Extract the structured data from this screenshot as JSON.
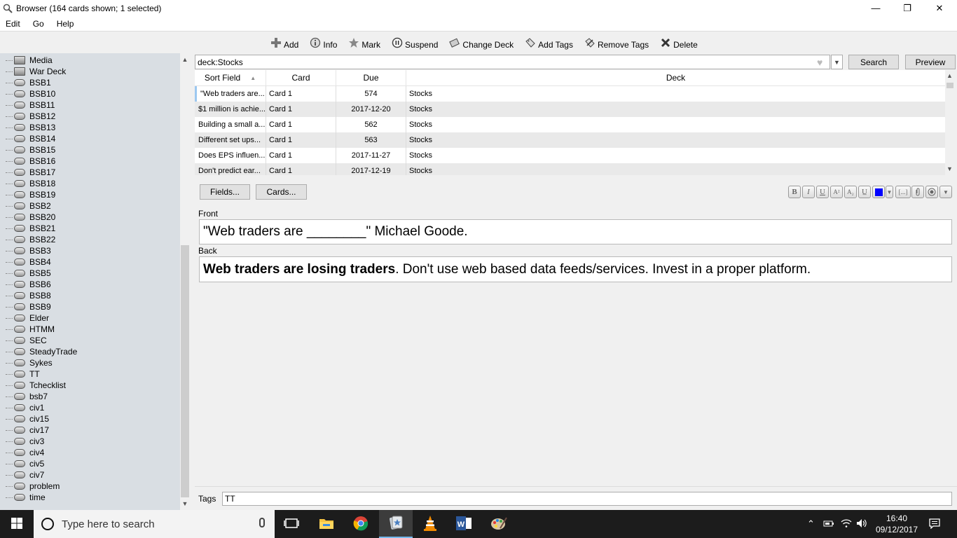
{
  "window": {
    "title": "Browser (164 cards shown; 1 selected)",
    "minimize": "—",
    "maximize": "❐",
    "close": "✕"
  },
  "menu": [
    "Edit",
    "Go",
    "Help"
  ],
  "toolbar": [
    {
      "label": "Add",
      "icon": "add-icon"
    },
    {
      "label": "Info",
      "icon": "info-icon"
    },
    {
      "label": "Mark",
      "icon": "star-icon"
    },
    {
      "label": "Suspend",
      "icon": "pause-icon"
    },
    {
      "label": "Change Deck",
      "icon": "deck-icon"
    },
    {
      "label": "Add Tags",
      "icon": "tag-add-icon"
    },
    {
      "label": "Remove Tags",
      "icon": "tag-remove-icon"
    },
    {
      "label": "Delete",
      "icon": "delete-icon"
    }
  ],
  "sidebar": {
    "items": [
      "Media",
      "War Deck",
      "BSB1",
      "BSB10",
      "BSB11",
      "BSB12",
      "BSB13",
      "BSB14",
      "BSB15",
      "BSB16",
      "BSB17",
      "BSB18",
      "BSB19",
      "BSB2",
      "BSB20",
      "BSB21",
      "BSB22",
      "BSB3",
      "BSB4",
      "BSB5",
      "BSB6",
      "BSB8",
      "BSB9",
      "Elder",
      "HTMM",
      "SEC",
      "SteadyTrade",
      "Sykes",
      "TT",
      "Tchecklist",
      "bsb7",
      "civ1",
      "civ15",
      "civ17",
      "civ3",
      "civ4",
      "civ5",
      "civ7",
      "problem",
      "time"
    ]
  },
  "search": {
    "value": "deck:Stocks",
    "search_label": "Search",
    "preview_label": "Preview"
  },
  "table": {
    "columns": [
      "Sort Field",
      "Card",
      "Due",
      "Deck"
    ],
    "rows": [
      {
        "sort_field": "\"Web traders are...",
        "card": "Card 1",
        "due": "574",
        "deck": "Stocks"
      },
      {
        "sort_field": "$1 million is achie...",
        "card": "Card 1",
        "due": "2017-12-20",
        "deck": "Stocks"
      },
      {
        "sort_field": "Building a small a...",
        "card": "Card 1",
        "due": "562",
        "deck": "Stocks"
      },
      {
        "sort_field": "Different set ups...",
        "card": "Card 1",
        "due": "563",
        "deck": "Stocks"
      },
      {
        "sort_field": "Does EPS influen...",
        "card": "Card 1",
        "due": "2017-11-27",
        "deck": "Stocks"
      },
      {
        "sort_field": "Don't predict ear...",
        "card": "Card 1",
        "due": "2017-12-19",
        "deck": "Stocks"
      }
    ]
  },
  "editor": {
    "fields_btn": "Fields...",
    "cards_btn": "Cards...",
    "format_buttons": [
      "B",
      "I",
      "U",
      "A²",
      "A₂",
      "U̲",
      "▼",
      "[...]",
      "⊕",
      "◉",
      "▼"
    ],
    "front_label": "Front",
    "front_value_a": "\"Web traders are ",
    "front_blank": "________",
    "front_value_b": "\" Michael Goode.",
    "back_label": "Back",
    "back_bold": "Web traders are losing traders",
    "back_rest": ". Don't use web based data feeds/services. Invest in a proper platform.",
    "tags_label": "Tags",
    "tags_value": "TT"
  },
  "taskbar": {
    "search_placeholder": "Type here to search",
    "time": "16:40",
    "date": "09/12/2017"
  },
  "colors": {
    "sidebar_bg": "#d9dee3",
    "taskbar_bg": "#1c1c1c",
    "selection_blue": "#0000ff"
  }
}
